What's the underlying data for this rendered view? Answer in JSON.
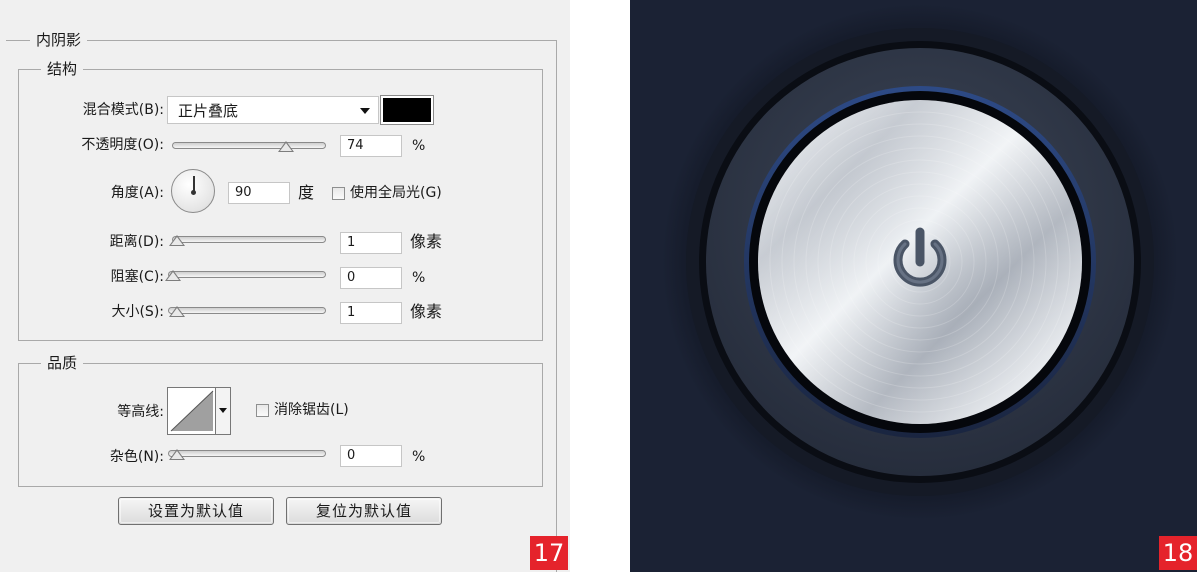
{
  "dialog": {
    "section_title": "内阴影",
    "structure": {
      "title": "结构",
      "blend_mode_label": "混合模式(B):",
      "blend_mode_value": "正片叠底",
      "shadow_color": "#000000",
      "opacity_label": "不透明度(O):",
      "opacity_value": "74",
      "opacity_unit": "%",
      "opacity_level": 0.74,
      "angle_label": "角度(A):",
      "angle_value": "90",
      "angle_unit": "度",
      "global_light_label": "使用全局光(G)",
      "global_light_checked": false,
      "distance_label": "距离(D):",
      "distance_value": "1",
      "distance_unit": "像素",
      "choke_label": "阻塞(C):",
      "choke_value": "0",
      "choke_unit": "%",
      "size_label": "大小(S):",
      "size_value": "1",
      "size_unit": "像素"
    },
    "quality": {
      "title": "品质",
      "contour_label": "等高线:",
      "anti_alias_label": "消除锯齿(L)",
      "anti_alias_checked": false,
      "noise_label": "杂色(N):",
      "noise_value": "0",
      "noise_unit": "%"
    },
    "buttons": {
      "set_default": "设置为默认值",
      "reset_default": "复位为默认值"
    },
    "step_badge": "17"
  },
  "preview": {
    "step_badge": "18",
    "icon": "power-icon"
  },
  "colors": {
    "badge": "#e5232b",
    "dialog_bg": "#f0f0f0",
    "preview_bg": "#1b2234"
  }
}
